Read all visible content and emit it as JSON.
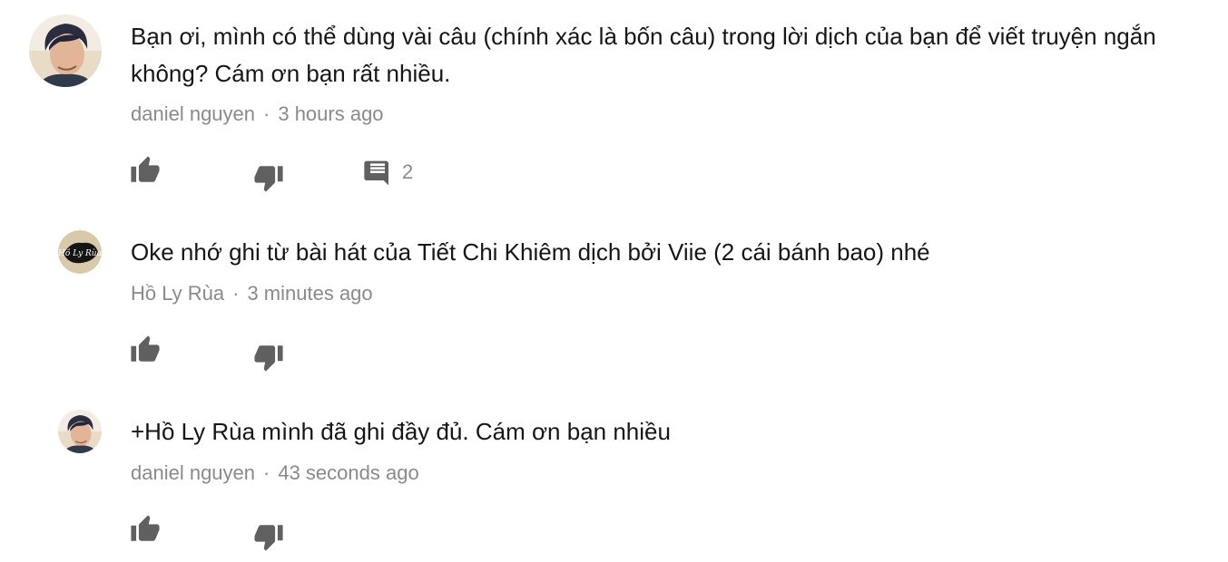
{
  "comments": [
    {
      "author": "daniel nguyen",
      "time": "3 hours ago",
      "text": "Bạn ơi, mình có thể dùng vài câu (chính xác là bốn câu) trong lời dịch của bạn để viết truyện ngắn\nkhông? Cám ơn bạn rất nhiều.",
      "reply_count": "2",
      "avatar": "profile-photo-icon"
    },
    {
      "author": "Hồ Ly Rùa",
      "time": "3 minutes ago",
      "text": "Oke nhớ ghi từ bài hát của Tiết Chi Khiêm dịch bởi Viie (2 cái bánh bao) nhé",
      "avatar": "logo-icon",
      "avatar_logo_text": "Hồ Ly Rùa"
    },
    {
      "author": "daniel nguyen",
      "time": "43 seconds ago",
      "text": "+Hồ Ly Rùa mình đã ghi đầy đủ. Cám ơn bạn nhiều",
      "avatar": "profile-photo-icon"
    }
  ],
  "colors": {
    "text": "#161616",
    "meta": "#8a8a8a",
    "icon": "#606060"
  },
  "meta_separator": "·"
}
